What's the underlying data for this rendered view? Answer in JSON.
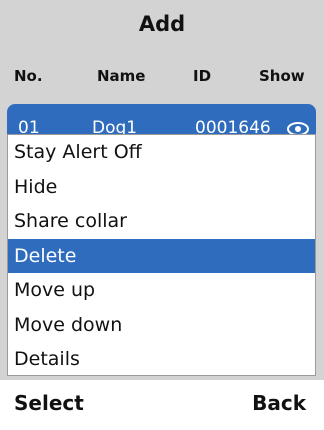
{
  "screen_title": "Add",
  "columns": {
    "no": "No.",
    "name": "Name",
    "id": "ID",
    "show": "Show"
  },
  "row": {
    "no": "01",
    "name": "Dog1",
    "id": "0001646",
    "show_icon": "eye-icon"
  },
  "menu": {
    "items": [
      {
        "label": "Stay Alert Off"
      },
      {
        "label": "Hide"
      },
      {
        "label": "Share collar"
      },
      {
        "label": "Delete"
      },
      {
        "label": "Move up"
      },
      {
        "label": "Move down"
      },
      {
        "label": "Details"
      }
    ],
    "selected_label": "Delete"
  },
  "softkeys": {
    "left": "Select",
    "right": "Back"
  },
  "colors": {
    "accent": "#2f6cbd",
    "background": "#d3d3d3",
    "menu_bg": "#ffffff"
  }
}
